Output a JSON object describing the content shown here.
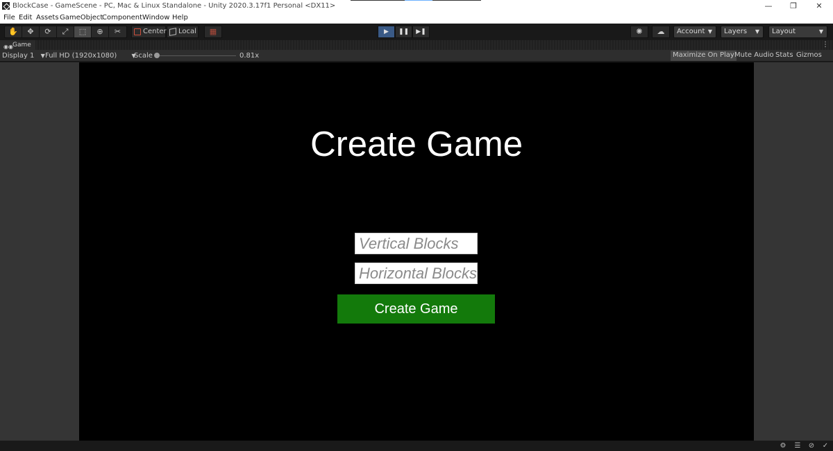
{
  "window": {
    "title": "BlockCase - GameScene - PC, Mac & Linux Standalone - Unity 2020.3.17f1 Personal <DX11>",
    "minimize_glyph": "—",
    "restore_glyph": "❐",
    "close_glyph": "✕"
  },
  "menu": {
    "items": [
      "File",
      "Edit",
      "Assets",
      "GameObject",
      "Component",
      "Window",
      "Help"
    ]
  },
  "toolbar": {
    "tools": [
      {
        "name": "hand-tool",
        "glyph": "✋"
      },
      {
        "name": "move-tool",
        "glyph": "✥"
      },
      {
        "name": "rotate-tool",
        "glyph": "⟳"
      },
      {
        "name": "scale-tool",
        "glyph": "⤢"
      },
      {
        "name": "rect-tool",
        "glyph": "⬚"
      },
      {
        "name": "transform-tool",
        "glyph": "⊕"
      },
      {
        "name": "custom-tool",
        "glyph": "✂"
      }
    ],
    "active_tool": "rect-tool",
    "pivot_label": "Center",
    "space_label": "Local",
    "snap_glyph": "▦",
    "play_glyph": "▶",
    "pause_glyph": "❚❚",
    "step_glyph": "▶❚",
    "play_state": "playing",
    "collab_glyph": "✺",
    "cloud_glyph": "☁",
    "account_label": "Account",
    "layers_label": "Layers",
    "layout_label": "Layout",
    "caret": "▼",
    "more_glyph": "⋮",
    "accent_color": "#3a5a86"
  },
  "game_tab": {
    "label": "Game",
    "icon": "gamepad-icon",
    "icon_glyph": "◉◉",
    "menu_glyph": "⋮"
  },
  "game_options": {
    "display": "Display 1",
    "resolution": "Full HD (1920x1080)",
    "scale_label": "Scale",
    "scale_value": "0.81x",
    "maximize_on_play": "Maximize On Play",
    "mute_audio": "Mute Audio",
    "stats": "Stats",
    "gizmos": "Gizmos",
    "maximize_on_play_enabled": true
  },
  "game_ui": {
    "title": "Create Game",
    "vertical_placeholder": "Vertical Blocks",
    "horizontal_placeholder": "Horizontal Blocks",
    "button_label": "Create Game",
    "button_color": "#137a0b"
  },
  "status_bar": {
    "icons": [
      {
        "name": "bug-icon",
        "glyph": "⚙"
      },
      {
        "name": "database-icon",
        "glyph": "☰"
      },
      {
        "name": "debug-icon",
        "glyph": "⊘"
      },
      {
        "name": "check-icon",
        "glyph": "✓"
      }
    ]
  }
}
